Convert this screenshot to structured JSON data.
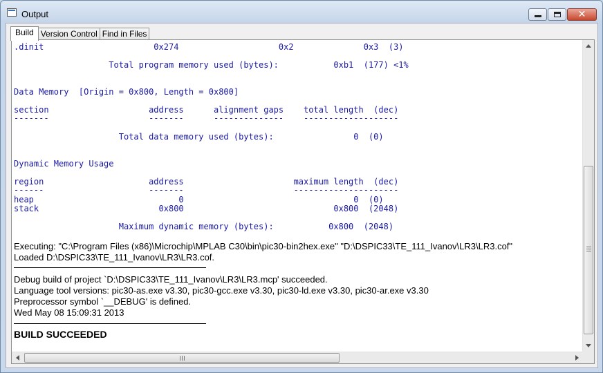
{
  "window": {
    "title": "Output"
  },
  "tabs": [
    {
      "label": "Build",
      "active": true
    },
    {
      "label": "Version Control",
      "active": false
    },
    {
      "label": "Find in Files",
      "active": false
    }
  ],
  "mono_lines": [
    ".dinit                      0x274                    0x2              0x3  (3)",
    "                   Total program memory used (bytes):           0xb1  (177) <1%",
    "",
    "Data Memory  [Origin = 0x800, Length = 0x800]",
    "section                    address      alignment gaps    total length  (dec)",
    "-------                    -------      --------------    -------------------",
    "                     Total data memory used (bytes):                0  (0)",
    "",
    "Dynamic Memory Usage",
    "region                     address                      maximum length  (dec)",
    "------                     -------                      ---------------------",
    "heap                             0                                  0  (0)",
    "stack                        0x800                              0x800  (2048)",
    "                     Maximum dynamic memory (bytes):           0x800  (2048)"
  ],
  "log_lines": [
    "Executing: \"C:\\Program Files (x86)\\Microchip\\MPLAB C30\\bin\\pic30-bin2hex.exe\" \"D:\\DSPIC33\\TE_111_Ivanov\\LR3\\LR3.cof\"",
    "Loaded D:\\DSPIC33\\TE_111_Ivanov\\LR3\\LR3.cof.",
    "Debug build of project `D:\\DSPIC33\\TE_111_Ivanov\\LR3\\LR3.mcp' succeeded.",
    "Language tool versions: pic30-as.exe v3.30, pic30-gcc.exe v3.30, pic30-ld.exe v3.30, pic30-ar.exe v3.30",
    "Preprocessor symbol `__DEBUG' is defined.",
    "Wed May 08 15:09:31 2013"
  ],
  "result": "BUILD SUCCEEDED",
  "colors": {
    "mono_text": "#1a1aa6",
    "log_text": "#000000"
  }
}
